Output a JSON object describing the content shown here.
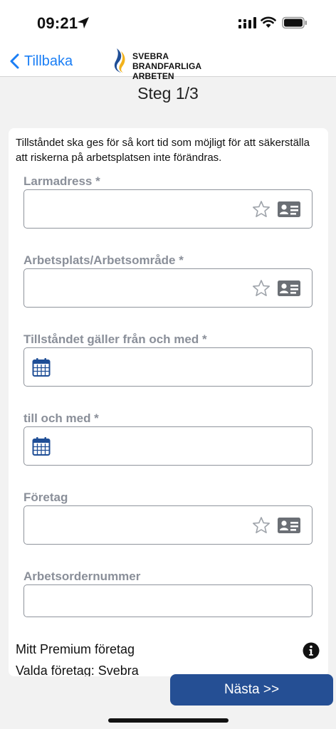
{
  "status_bar": {
    "time": "09:21"
  },
  "nav": {
    "back_label": "Tillbaka",
    "logo_line1": "SVEBRA",
    "logo_line2": "BRANDFARLIGA ARBETEN"
  },
  "step_title": "Steg 1/3",
  "intro_text": "Tillståndet ska ges för så kort tid som möjligt för att säkerställa att riskerna på arbetsplatsen inte förändras.",
  "form": {
    "alarm_address_label": "Larmadress *",
    "workplace_label": "Arbetsplats/Arbetsområde *",
    "valid_from_label": "Tillståndet gäller från och med *",
    "valid_to_label": "till och med *",
    "company_label": "Företag",
    "work_order_label": "Arbetsordernummer"
  },
  "premium": {
    "title": "Mitt Premium företag",
    "selected": "Valda företag: Svebra"
  },
  "next_button": "Nästa >>",
  "colors": {
    "accent_blue": "#1a7ef5",
    "button_blue": "#254f94",
    "label_gray": "#8a8f99",
    "calendar_blue": "#1f4e96"
  }
}
